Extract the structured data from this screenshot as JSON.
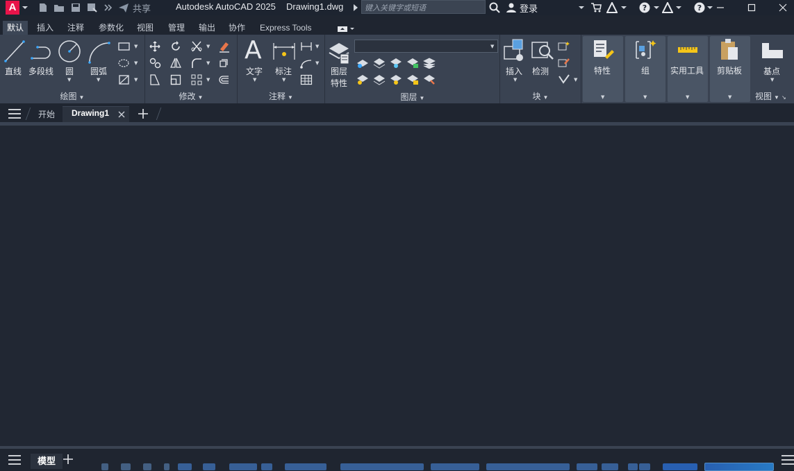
{
  "app": {
    "logo_letter": "A",
    "title": "Autodesk AutoCAD 2025",
    "filename": "Drawing1.dwg",
    "search_placeholder": "键入关键字或短语",
    "share_label": "共享",
    "login_label": "登录"
  },
  "ribbon_tabs": [
    {
      "label": "默认",
      "active": true
    },
    {
      "label": "插入"
    },
    {
      "label": "注释"
    },
    {
      "label": "参数化"
    },
    {
      "label": "视图"
    },
    {
      "label": "管理"
    },
    {
      "label": "输出"
    },
    {
      "label": "协作"
    },
    {
      "label": "Express Tools"
    }
  ],
  "panels": {
    "draw": {
      "title": "绘图",
      "line": "直线",
      "polyline": "多段线",
      "circle": "圆",
      "arc": "圆弧"
    },
    "modify": {
      "title": "修改"
    },
    "annotation": {
      "title": "注释",
      "text": "文字",
      "dimension": "标注"
    },
    "layers": {
      "title": "图层",
      "layer_props_1": "图层",
      "layer_props_2": "特性"
    },
    "block": {
      "title": "块",
      "insert": "插入",
      "inspect": "检测"
    },
    "properties": {
      "label": "特性"
    },
    "groups": {
      "label": "组"
    },
    "utilities": {
      "label": "实用工具"
    },
    "clipboard": {
      "label": "剪贴板"
    },
    "view": {
      "title": "视图",
      "basepoint": "基点"
    }
  },
  "doc_tabs": {
    "start": "开始",
    "drawing": "Drawing1"
  },
  "status": {
    "model_tab": "模型"
  },
  "colors": {
    "accent_logo": "#e8144a",
    "ribbon_bg": "#3a4352",
    "canvas_bg": "#212733",
    "status_highlight": "#2a8ae0"
  }
}
